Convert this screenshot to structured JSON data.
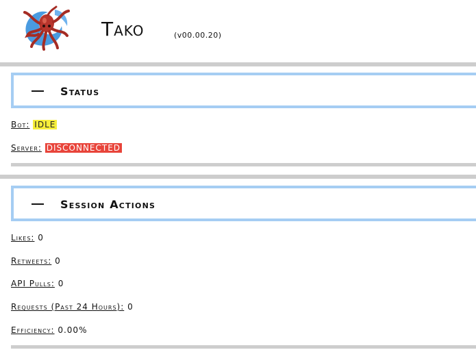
{
  "header": {
    "title": "Tako",
    "version": "(v00.00.20)",
    "logo_icon": "octopus-logo"
  },
  "status": {
    "title": "Status",
    "collapse_symbol": "—",
    "bot_label": "Bot:",
    "bot_value": "IDLE",
    "bot_color": "#f6ee3a",
    "server_label": "Server:",
    "server_value": "DISCONNECTED",
    "server_color": "#e8443a"
  },
  "session_actions": {
    "title": "Session Actions",
    "collapse_symbol": "—",
    "items": [
      {
        "label": "Likes:",
        "value": "0"
      },
      {
        "label": "Retweets:",
        "value": "0"
      },
      {
        "label": "API Pulls:",
        "value": "0"
      },
      {
        "label": "Requests (Past 24 Hours):",
        "value": "0"
      },
      {
        "label": "Efficiency:",
        "value": "0.00%"
      }
    ]
  },
  "colors": {
    "section_border": "#a5cdf3",
    "divider": "#cdcdcd"
  }
}
